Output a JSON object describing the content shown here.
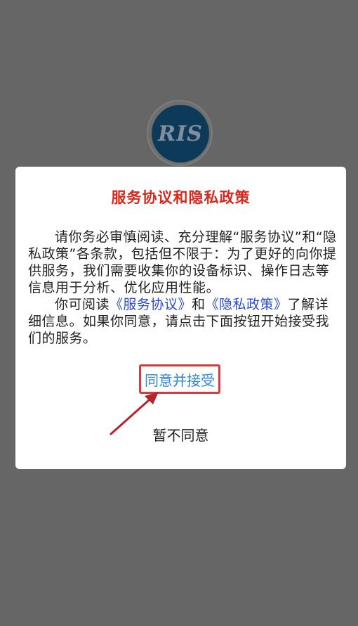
{
  "logo": {
    "text": "RIS"
  },
  "dialog": {
    "title": "服务协议和隐私政策",
    "paragraph1": "请你务必审慎阅读、充分理解“服务协议”和“隐私政策”各条款，包括但不限于：为了更好的向你提供服务，我们需要收集你的设备标识、操作日志等信息用于分析、优化应用性能。",
    "paragraph2_prefix": "你可阅读",
    "service_link": "《服务协议》",
    "paragraph2_and": "和",
    "privacy_link": "《隐私政策》",
    "paragraph2_suffix": "了解详细信息。如果你同意，请点击下面按钮开始接受我们的服务。",
    "agree_label": "同意并接受",
    "disagree_label": "暂不同意"
  },
  "colors": {
    "overlay": "#666666",
    "title": "#d6281c",
    "link": "#2a4bd8",
    "agree_text": "#2f86d6",
    "highlight": "#e03640",
    "arrow": "#b5252c"
  }
}
